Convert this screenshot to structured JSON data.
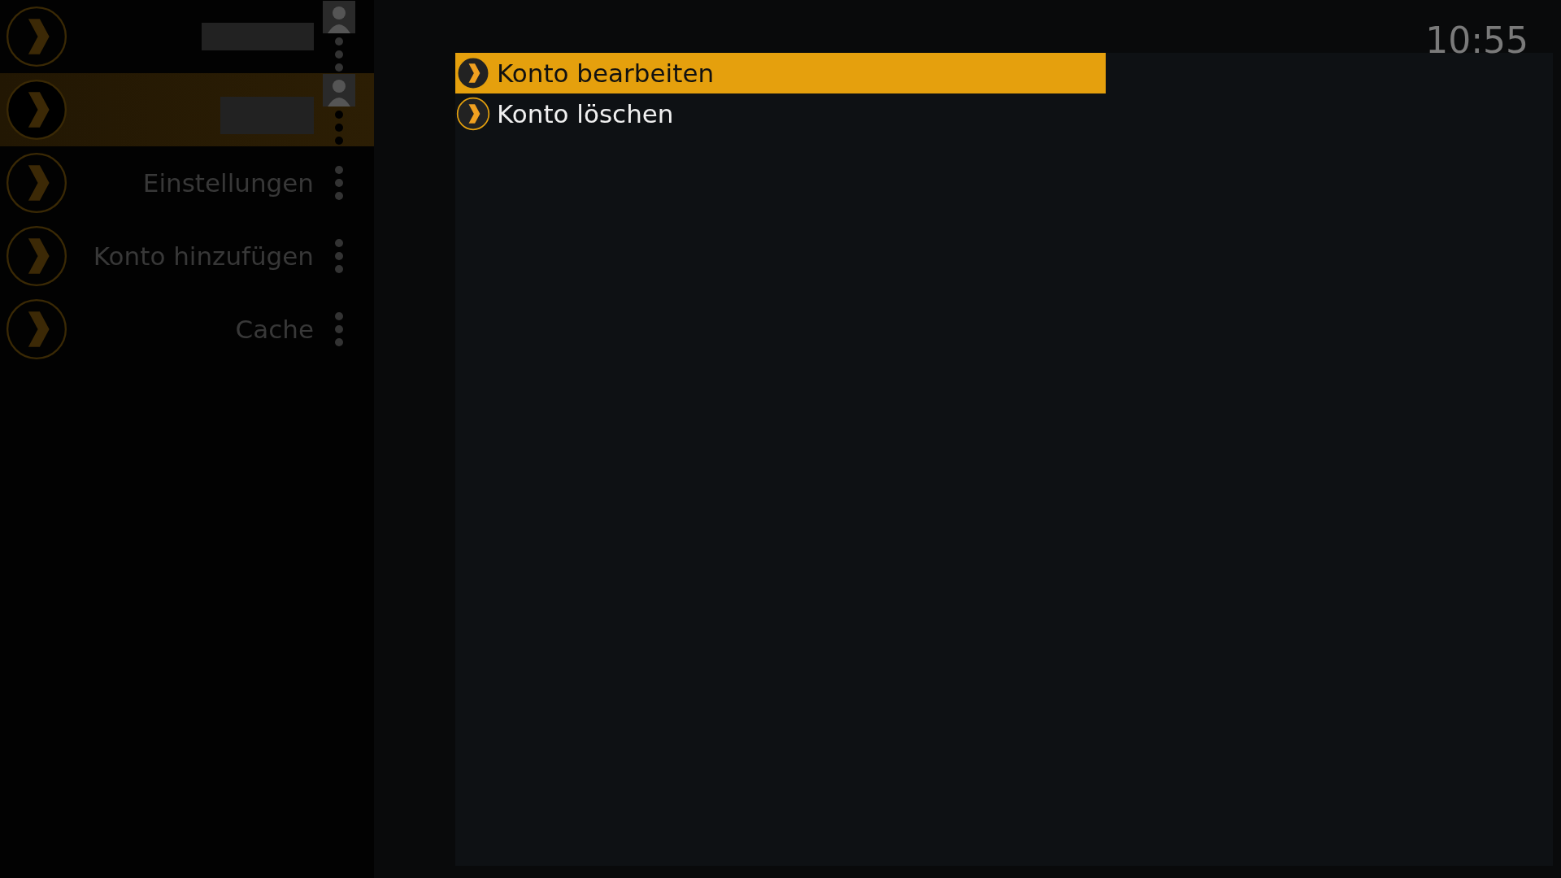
{
  "sidebar": {
    "items": [
      {
        "kind": "account",
        "selected": false
      },
      {
        "kind": "account",
        "selected": true
      },
      {
        "kind": "action",
        "label": "Einstellungen",
        "selected": false
      },
      {
        "kind": "action",
        "label": "Konto hinzufügen",
        "selected": false
      },
      {
        "kind": "action",
        "label": "Cache",
        "selected": false
      }
    ]
  },
  "menu": {
    "items": [
      {
        "label": "Konto bearbeiten",
        "selected": true
      },
      {
        "label": "Konto löschen",
        "selected": false
      }
    ]
  },
  "clock": "10:55"
}
